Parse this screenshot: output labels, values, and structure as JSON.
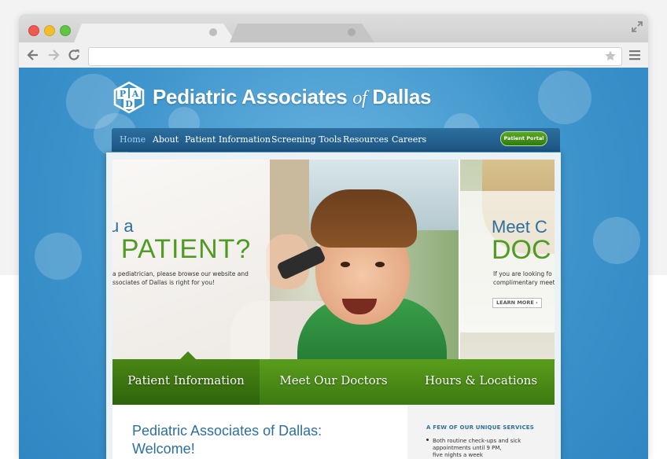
{
  "site": {
    "brand_main": "Pediatric Associates",
    "brand_of": "of",
    "brand_city": "Dallas",
    "logo_letters": "PAD"
  },
  "nav": {
    "items": [
      "Home",
      "About",
      "Patient Information",
      "Screening Tools",
      "Resources",
      "Careers"
    ],
    "active": "Home",
    "portal_label": "Patient Portal"
  },
  "hero": {
    "left_intro": "u a",
    "left_big": "/ PATIENT?",
    "left_body_line1": "a pediatrician, please browse our website and",
    "left_body_line2": "ssociates of Dallas is right for you!",
    "right_intro": "Meet C",
    "right_big": "DOC",
    "right_body_line1": "If you are looking fo",
    "right_body_line2": "complimentary meeti",
    "learn_more": "LEARN MORE"
  },
  "feature_tabs": [
    "Patient Information",
    "Meet Our Doctors",
    "Hours & Locations"
  ],
  "content": {
    "welcome_line1": "Pediatric Associates of Dallas:",
    "welcome_line2": "Welcome!",
    "sidebar_title": "A FEW OF OUR UNIQUE SERVICES",
    "sidebar_item_line1": "Both routine check-ups and sick",
    "sidebar_item_line2": "appointments until 9 PM,",
    "sidebar_item_line3": "five nights a week"
  },
  "colors": {
    "brand_blue": "#2e6f9d",
    "brand_green": "#4f9b24",
    "background_blue": "#3f95cc"
  }
}
